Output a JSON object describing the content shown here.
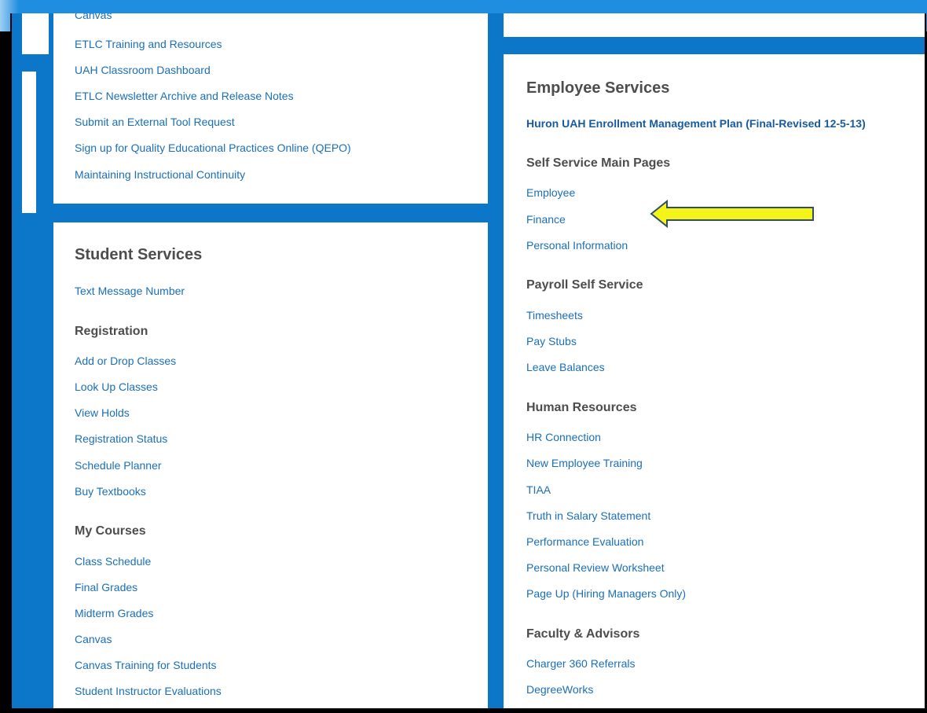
{
  "left_top": {
    "links": [
      "Canvas",
      "ETLC Training and Resources",
      "UAH Classroom Dashboard",
      "ETLC Newsletter Archive and Release Notes",
      "Submit an External Tool Request",
      "Sign up for Quality Educational Practices Online (QEPO)",
      "Maintaining Instructional Continuity"
    ]
  },
  "student": {
    "title": "Student Services",
    "text_message": "Text Message Number",
    "registration": {
      "heading": "Registration",
      "links": [
        "Add or Drop Classes",
        "Look Up Classes",
        "View Holds",
        "Registration Status",
        "Schedule Planner",
        "Buy Textbooks"
      ]
    },
    "courses": {
      "heading": "My Courses",
      "links": [
        "Class Schedule",
        "Final Grades",
        "Midterm Grades",
        "Canvas",
        "Canvas Training for Students",
        "Student Instructor Evaluations"
      ]
    }
  },
  "employee": {
    "title": "Employee Services",
    "plan_link": "Huron UAH Enrollment Management Plan (Final-Revised 12-5-13)",
    "self_service": {
      "heading": "Self Service Main Pages",
      "links": [
        "Employee",
        "Finance",
        "Personal Information"
      ]
    },
    "payroll": {
      "heading": "Payroll Self Service",
      "links": [
        "Timesheets",
        "Pay Stubs",
        "Leave Balances"
      ]
    },
    "hr": {
      "heading": "Human Resources",
      "links": [
        "HR Connection",
        "New Employee Training",
        "TIAA",
        "Truth in Salary Statement",
        "Performance Evaluation",
        "Personal Review Worksheet",
        "Page Up (Hiring Managers Only)"
      ]
    },
    "faculty": {
      "heading": "Faculty & Advisors",
      "links": [
        "Charger 360 Referrals",
        "DegreeWorks"
      ]
    }
  },
  "colors": {
    "accent": "#0c76c8",
    "link": "#1a6fb8",
    "arrow_fill": "#f4f41a",
    "arrow_stroke": "#2f4f66"
  },
  "annotation": {
    "icon": "left-arrow-icon"
  }
}
